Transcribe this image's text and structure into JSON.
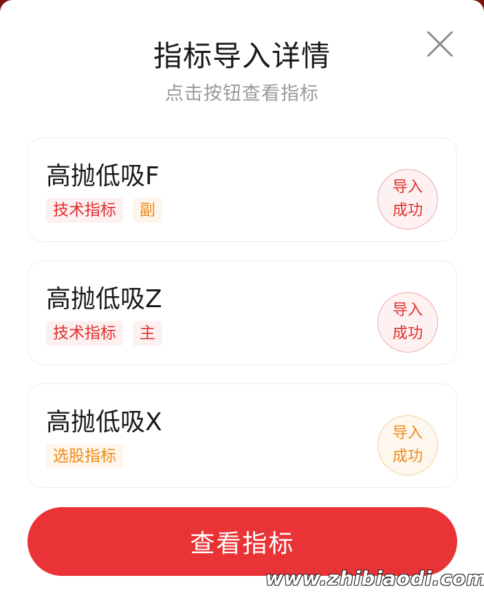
{
  "modal": {
    "title": "指标导入详情",
    "subtitle": "点击按钮查看指标"
  },
  "items": [
    {
      "name": "高抛低吸F",
      "tags": [
        {
          "label": "技术指标",
          "color": "red"
        },
        {
          "label": "副",
          "color": "orange"
        }
      ],
      "status_line1": "导入",
      "status_line2": "成功",
      "status_color": "red"
    },
    {
      "name": "高抛低吸Z",
      "tags": [
        {
          "label": "技术指标",
          "color": "red"
        },
        {
          "label": "主",
          "color": "red"
        }
      ],
      "status_line1": "导入",
      "status_line2": "成功",
      "status_color": "red"
    },
    {
      "name": "高抛低吸X",
      "tags": [
        {
          "label": "选股指标",
          "color": "orange"
        }
      ],
      "status_line1": "导入",
      "status_line2": "成功",
      "status_color": "orange"
    }
  ],
  "button": {
    "label": "查看指标"
  },
  "watermark": "www.zhibiaodi.com",
  "colors": {
    "accent": "#e93336",
    "tag_red": "#e0302e",
    "tag_orange": "#ee8a1a"
  }
}
